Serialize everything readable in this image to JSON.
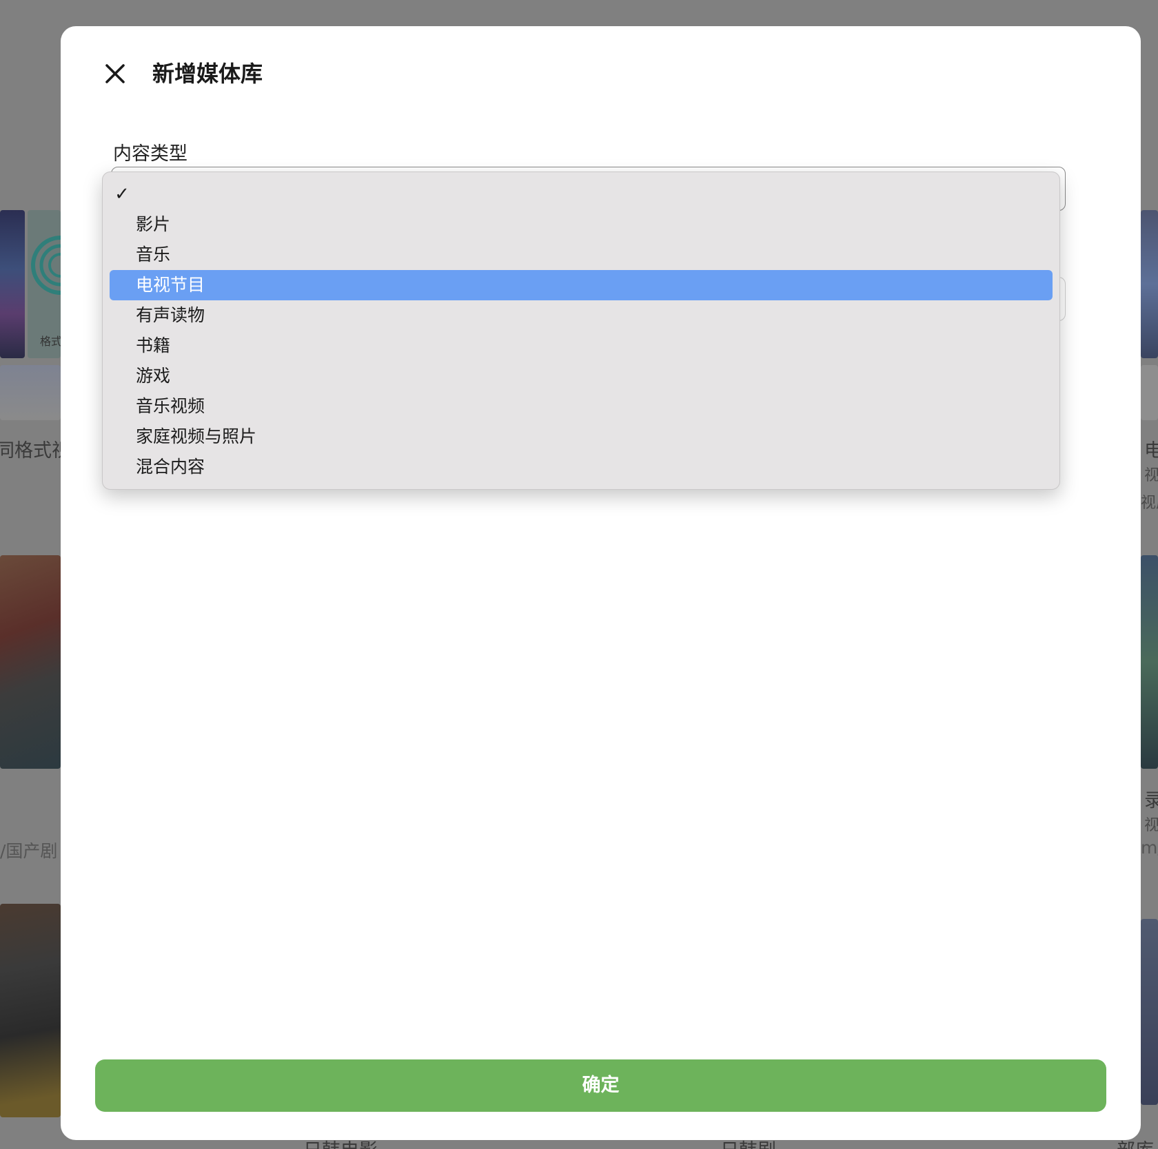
{
  "dialog": {
    "title": "新增媒体库",
    "close_icon": "close-icon",
    "field_label": "内容类型",
    "confirm_label": "确定"
  },
  "dropdown": {
    "check_glyph": "✓",
    "selected_index": 3,
    "options": [
      {
        "label": "",
        "checked": true
      },
      {
        "label": "影片"
      },
      {
        "label": "音乐"
      },
      {
        "label": "电视节目",
        "highlighted": true
      },
      {
        "label": "有声读物"
      },
      {
        "label": "书籍"
      },
      {
        "label": "游戏"
      },
      {
        "label": "音乐视频"
      },
      {
        "label": "家庭视频与照片"
      },
      {
        "label": "混合内容"
      }
    ]
  },
  "background": {
    "left_texts": [
      "同格式视",
      "/国产剧"
    ],
    "left_caption": "格式",
    "right_texts": [
      "电",
      "视",
      "视屏",
      "录",
      "视",
      "m/s"
    ],
    "bottom_texts": [
      "日韩电影",
      "日韩剧",
      "部库"
    ]
  },
  "colors": {
    "highlight": "#6a9ff3",
    "confirm": "#6db35b",
    "overlay": "#808080"
  }
}
